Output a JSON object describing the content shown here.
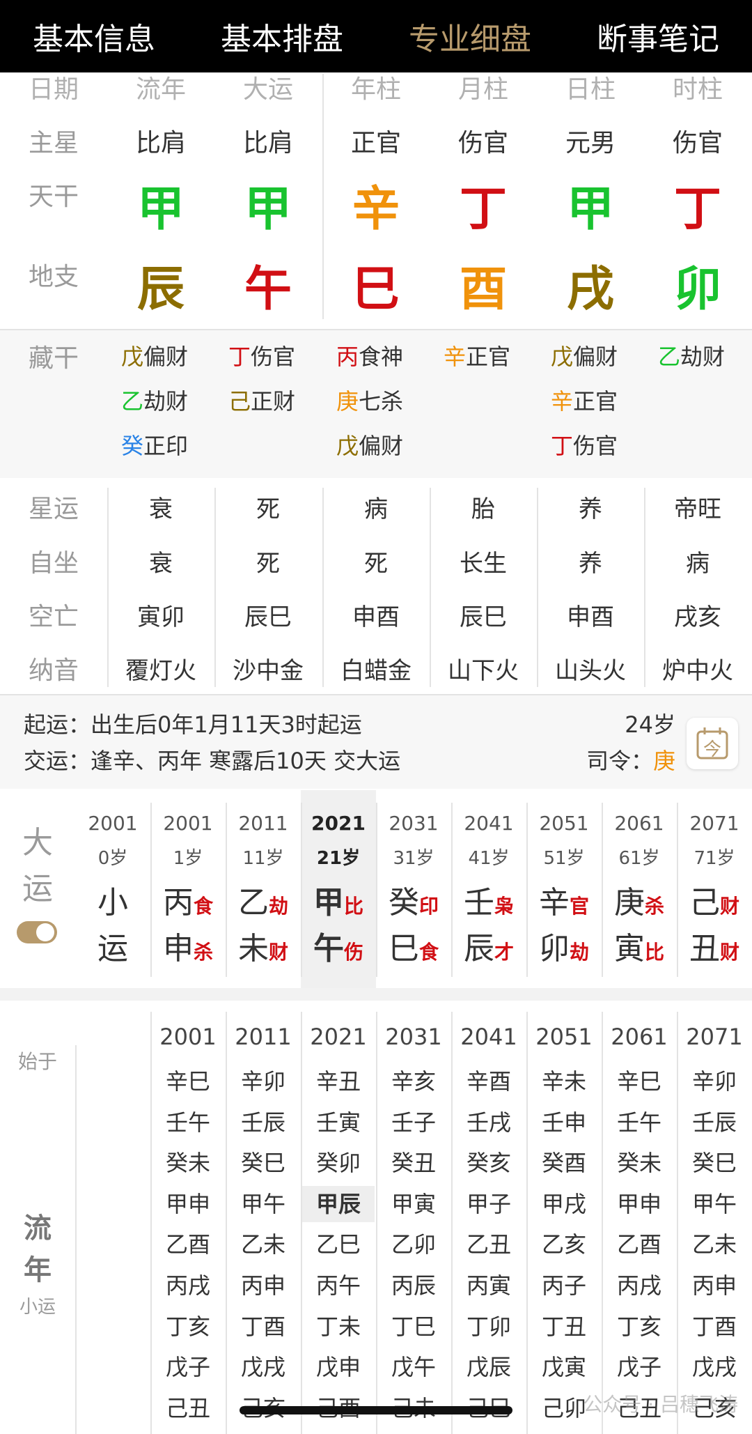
{
  "tabs": [
    "基本信息",
    "基本排盘",
    "专业细盘",
    "断事笔记"
  ],
  "active_tab": 2,
  "grid": {
    "header": [
      "日期",
      "流年",
      "大运",
      "年柱",
      "月柱",
      "日柱",
      "时柱"
    ],
    "main_star": {
      "label": "主星",
      "values": [
        "比肩",
        "比肩",
        "正官",
        "伤官",
        "元男",
        "伤官"
      ]
    },
    "tiangan": {
      "label": "天干",
      "values": [
        "甲",
        "甲",
        "辛",
        "丁",
        "甲",
        "丁"
      ],
      "colors": [
        "#19c32f",
        "#19c32f",
        "#f0920b",
        "#d10f14",
        "#19c32f",
        "#d10f14"
      ]
    },
    "dizhi": {
      "label": "地支",
      "values": [
        "辰",
        "午",
        "巳",
        "酉",
        "戌",
        "卯"
      ],
      "colors": [
        "#8c6d00",
        "#d10f14",
        "#d10f14",
        "#f0920b",
        "#8c6d00",
        "#19c32f"
      ]
    }
  },
  "canggan": {
    "label": "藏干",
    "cols": [
      [
        {
          "g": "戊",
          "t": "偏财",
          "c": "#8c6d00"
        },
        {
          "g": "乙",
          "t": "劫财",
          "c": "#19c32f"
        },
        {
          "g": "癸",
          "t": "正印",
          "c": "#2a83e6"
        }
      ],
      [
        {
          "g": "丁",
          "t": "伤官",
          "c": "#d10f14"
        },
        {
          "g": "己",
          "t": "正财",
          "c": "#8c6d00"
        }
      ],
      [
        {
          "g": "丙",
          "t": "食神",
          "c": "#d10f14"
        },
        {
          "g": "庚",
          "t": "七杀",
          "c": "#f0920b"
        },
        {
          "g": "戊",
          "t": "偏财",
          "c": "#8c6d00"
        }
      ],
      [
        {
          "g": "辛",
          "t": "正官",
          "c": "#f0920b"
        }
      ],
      [
        {
          "g": "戊",
          "t": "偏财",
          "c": "#8c6d00"
        },
        {
          "g": "辛",
          "t": "正官",
          "c": "#f0920b"
        },
        {
          "g": "丁",
          "t": "伤官",
          "c": "#d10f14"
        }
      ],
      [
        {
          "g": "乙",
          "t": "劫财",
          "c": "#19c32f"
        }
      ]
    ]
  },
  "rows2": [
    {
      "label": "星运",
      "values": [
        "衰",
        "死",
        "病",
        "胎",
        "养",
        "帝旺"
      ]
    },
    {
      "label": "自坐",
      "values": [
        "衰",
        "死",
        "死",
        "长生",
        "养",
        "病"
      ]
    },
    {
      "label": "空亡",
      "values": [
        "寅卯",
        "辰巳",
        "申酉",
        "辰巳",
        "申酉",
        "戌亥"
      ]
    },
    {
      "label": "纳音",
      "values": [
        "覆灯火",
        "沙中金",
        "白蜡金",
        "山下火",
        "山头火",
        "炉中火"
      ]
    }
  ],
  "qiyun": {
    "line1": "起运：出生后0年1月11天3时起运",
    "line2": "交运：逢辛、丙年 寒露后10天 交大运",
    "age": "24岁",
    "siling_label": "司令：",
    "siling_value": "庚",
    "calendar_icon_text": "今"
  },
  "dayun": {
    "label": "大运",
    "columns": [
      {
        "year": "2001",
        "age": "0岁",
        "g": "小",
        "gt": "",
        "z": "运",
        "zt": "",
        "gc": "#333",
        "zc": "#333"
      },
      {
        "year": "2001",
        "age": "1岁",
        "g": "丙",
        "gt": "食",
        "z": "申",
        "zt": "杀",
        "gc": "#333",
        "zc": "#333"
      },
      {
        "year": "2011",
        "age": "11岁",
        "g": "乙",
        "gt": "劫",
        "z": "未",
        "zt": "财",
        "gc": "#333",
        "zc": "#333"
      },
      {
        "year": "2021",
        "age": "21岁",
        "g": "甲",
        "gt": "比",
        "z": "午",
        "zt": "伤",
        "gc": "#333",
        "zc": "#333"
      },
      {
        "year": "2031",
        "age": "31岁",
        "g": "癸",
        "gt": "印",
        "z": "巳",
        "zt": "食",
        "gc": "#333",
        "zc": "#333"
      },
      {
        "year": "2041",
        "age": "41岁",
        "g": "壬",
        "gt": "枭",
        "z": "辰",
        "zt": "才",
        "gc": "#333",
        "zc": "#333"
      },
      {
        "year": "2051",
        "age": "51岁",
        "g": "辛",
        "gt": "官",
        "z": "卯",
        "zt": "劫",
        "gc": "#333",
        "zc": "#333"
      },
      {
        "year": "2061",
        "age": "61岁",
        "g": "庚",
        "gt": "杀",
        "z": "寅",
        "zt": "比",
        "gc": "#333",
        "zc": "#333"
      },
      {
        "year": "2071",
        "age": "71岁",
        "g": "己",
        "gt": "财",
        "z": "丑",
        "zt": "财",
        "gc": "#333",
        "zc": "#333"
      }
    ],
    "selected": 3
  },
  "liunian": {
    "start_label": "始于",
    "label1": "流",
    "label2": "年",
    "sub": "小运",
    "columns": [
      {
        "year": "2001",
        "items": [
          "辛巳",
          "壬午",
          "癸未",
          "甲申",
          "乙酉",
          "丙戌",
          "丁亥",
          "戊子",
          "己丑"
        ]
      },
      {
        "year": "2011",
        "items": [
          "辛卯",
          "壬辰",
          "癸巳",
          "甲午",
          "乙未",
          "丙申",
          "丁酉",
          "戊戌",
          "己亥"
        ]
      },
      {
        "year": "2021",
        "items": [
          "辛丑",
          "壬寅",
          "癸卯",
          "甲辰",
          "乙巳",
          "丙午",
          "丁未",
          "戊申",
          "己酉"
        ]
      },
      {
        "year": "2031",
        "items": [
          "辛亥",
          "壬子",
          "癸丑",
          "甲寅",
          "乙卯",
          "丙辰",
          "丁巳",
          "戊午",
          "己未"
        ]
      },
      {
        "year": "2041",
        "items": [
          "辛酉",
          "壬戌",
          "癸亥",
          "甲子",
          "乙丑",
          "丙寅",
          "丁卯",
          "戊辰",
          "己巳"
        ]
      },
      {
        "year": "2051",
        "items": [
          "辛未",
          "壬申",
          "癸酉",
          "甲戌",
          "乙亥",
          "丙子",
          "丁丑",
          "戊寅",
          "己卯"
        ]
      },
      {
        "year": "2061",
        "items": [
          "辛巳",
          "壬午",
          "癸未",
          "甲申",
          "乙酉",
          "丙戌",
          "丁亥",
          "戊子",
          "己丑"
        ]
      },
      {
        "year": "2071",
        "items": [
          "辛卯",
          "壬辰",
          "癸巳",
          "甲午",
          "乙未",
          "丙申",
          "丁酉",
          "戊戌",
          "己亥"
        ]
      }
    ],
    "highlight": {
      "col": 2,
      "row": 3
    }
  },
  "watermark": "公众号 · 吕穗飞涛"
}
